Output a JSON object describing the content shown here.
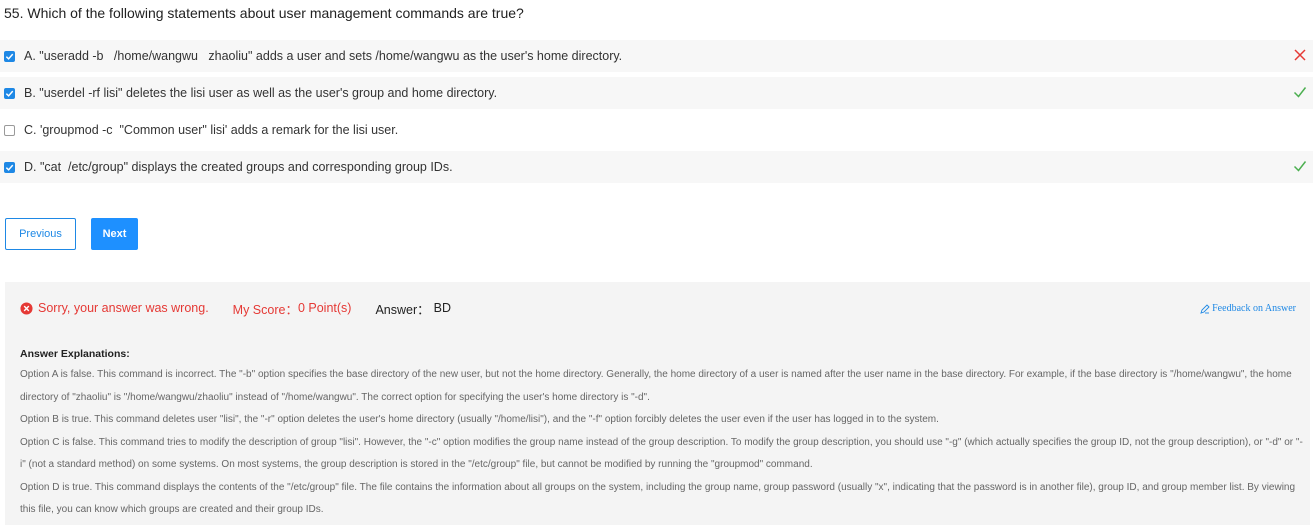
{
  "question": {
    "title": "55. Which of the following statements about user management commands are true?"
  },
  "options": [
    {
      "text": "A. \"useradd -b   /home/wangwu   zhaoliu\" adds a user and sets /home/wangwu as the user's home directory.",
      "checked": true,
      "result": "wrong"
    },
    {
      "text": "B. \"userdel -rf lisi\" deletes the lisi user as well as the user's group and home directory.",
      "checked": true,
      "result": "correct"
    },
    {
      "text": "C. 'groupmod -c  \"Common user\" lisi' adds a remark for the lisi user.",
      "checked": false,
      "result": "none"
    },
    {
      "text": "D. \"cat  /etc/group\" displays the created groups and corresponding group IDs.",
      "checked": true,
      "result": "correct"
    }
  ],
  "buttons": {
    "previous": "Previous",
    "next": "Next"
  },
  "result": {
    "status_text": "Sorry, your answer was wrong.",
    "score_label": "My Score：",
    "score_value": "0 Point(s)",
    "answer_label": "Answer：",
    "answer_value": "BD",
    "feedback_link": "Feedback on Answer"
  },
  "explanations": {
    "heading": "Answer Explanations:",
    "paragraphs": [
      "Option A is false. This command is incorrect. The \"-b\" option specifies the base directory of the new user, but not the home directory. Generally, the home directory of a user is named after the user name in the base directory. For example, if the base directory is \"/home/wangwu\", the home directory of \"zhaoliu\" is \"/home/wangwu/zhaoliu\" instead of \"/home/wangwu\". The correct option for specifying the user's home directory is \"-d\".",
      "Option B is true. This command deletes user \"lisi\", the \"-r\" option deletes the user's home directory (usually \"/home/lisi\"), and the \"-f\" option forcibly deletes the user even if the user has logged in to the system.",
      "Option C is false. This command tries to modify the description of group \"lisi\". However, the \"-c\" option modifies the group name instead of the group description. To modify the group description, you should use \"-g\" (which actually specifies the group ID, not the group description), or \"-d\" or \"-i\" (not a standard method) on some systems. On most systems, the group description is stored in the \"/etc/group\" file, but cannot be modified by running the \"groupmod\" command.",
      "Option D is true. This command displays the contents of the \"/etc/group\" file. The file contains the information about all groups on the system, including the group name, group password (usually \"x\", indicating that the password is in another file), group ID, and group member list. By viewing this file, you can know which groups are created and their group IDs."
    ]
  },
  "colors": {
    "accent": "#1e88e5",
    "wrong": "#e53935",
    "correct": "#4caf50"
  }
}
